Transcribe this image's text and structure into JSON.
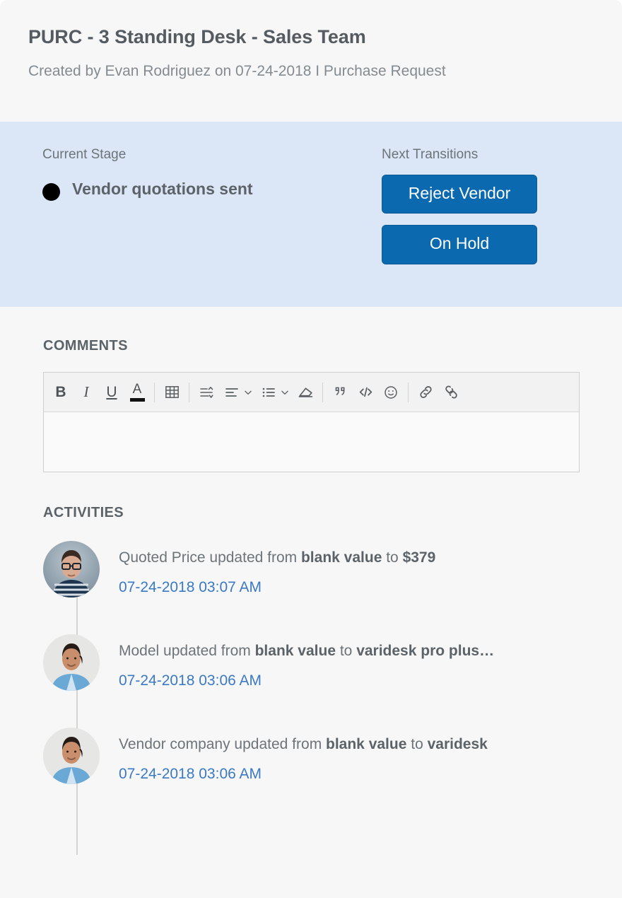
{
  "header": {
    "title": "PURC - 3 Standing Desk - Sales Team",
    "subtitle": "Created by Evan Rodriguez on 07-24-2018 I Purchase Request"
  },
  "stage": {
    "current_stage_label": "Current Stage",
    "current_stage_name": "Vendor quotations sent",
    "next_transitions_label": "Next Transitions",
    "transitions": [
      {
        "label": "Reject Vendor"
      },
      {
        "label": "On Hold"
      }
    ]
  },
  "comments": {
    "heading": "COMMENTS",
    "editor_value": "",
    "toolbar": [
      {
        "name": "bold",
        "glyph": "B"
      },
      {
        "name": "italic",
        "glyph": "I"
      },
      {
        "name": "underline",
        "glyph": "U"
      },
      {
        "name": "font-color",
        "glyph": "A"
      },
      {
        "name": "table",
        "glyph": ""
      },
      {
        "name": "line-height",
        "glyph": ""
      },
      {
        "name": "align",
        "glyph": ""
      },
      {
        "name": "list",
        "glyph": ""
      },
      {
        "name": "clear-format",
        "glyph": ""
      },
      {
        "name": "blockquote",
        "glyph": ""
      },
      {
        "name": "code",
        "glyph": ""
      },
      {
        "name": "emoji",
        "glyph": ""
      },
      {
        "name": "link",
        "glyph": ""
      },
      {
        "name": "unlink",
        "glyph": ""
      }
    ]
  },
  "activities": {
    "heading": "ACTIVITIES",
    "items": [
      {
        "prefix": "Quoted Price updated from ",
        "old_value": "blank value",
        "middle": " to ",
        "new_value": "$379",
        "timestamp": "07-24-2018 03:07 AM",
        "avatar": "man-glasses-striped-shirt"
      },
      {
        "prefix": "Model updated from ",
        "old_value": "blank value",
        "middle": " to ",
        "new_value": "varidesk pro plus…",
        "timestamp": "07-24-2018 03:06 AM",
        "avatar": "woman-denim-shirt"
      },
      {
        "prefix": "Vendor company updated from ",
        "old_value": "blank value",
        "middle": " to ",
        "new_value": "varidesk",
        "timestamp": "07-24-2018 03:06 AM",
        "avatar": "woman-denim-shirt"
      }
    ]
  },
  "colors": {
    "panel_background": "#dbe6f6",
    "button": "#0b69b0",
    "link": "#3b79c4",
    "page_background": "#f7f7f7",
    "text_primary": "#5c6368",
    "text_secondary": "#6d7479"
  }
}
